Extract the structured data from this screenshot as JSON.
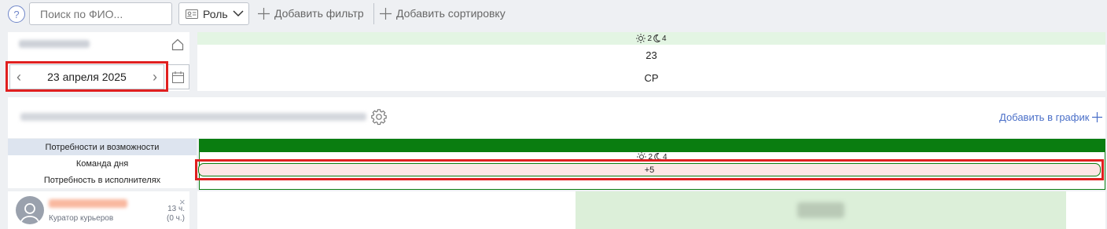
{
  "toolbar": {
    "help_label": "?",
    "search_placeholder": "Поиск по ФИО...",
    "role_label": "Роль",
    "add_filter_label": "Добавить фильтр",
    "add_sort_label": "Добавить сортировку"
  },
  "date_panel": {
    "date": "23 апреля 2025",
    "prev": "‹",
    "next": "›"
  },
  "day": {
    "shift_day_count": "2",
    "shift_night_count": "4",
    "number": "23",
    "weekday": "СР"
  },
  "team": {
    "add_schedule_label": "Добавить в график"
  },
  "rows": {
    "needs_label": "Потребности и возможности",
    "team_label": "Команда дня",
    "staff_need_label": "Потребность в исполнителях",
    "team_day_count": "2",
    "team_night_count": "4",
    "staff_need_value": "+5"
  },
  "person": {
    "role": "Куратор курьеров",
    "hours": "13 ч.",
    "hours_extra": "(0 ч.)",
    "close": "×"
  },
  "colors": {
    "accent_blue": "#4a6fc8",
    "needs_green": "#0a7d10",
    "need_cell_pink": "#fde7e5",
    "highlight_red": "#e01f1f"
  }
}
